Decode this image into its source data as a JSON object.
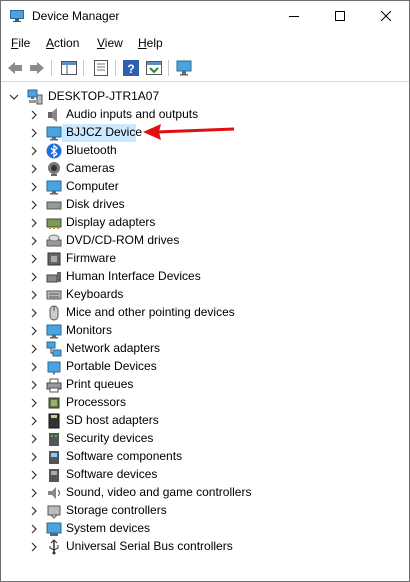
{
  "window": {
    "title": "Device Manager"
  },
  "menu": [
    {
      "first": "F",
      "rest": "ile"
    },
    {
      "first": "A",
      "rest": "ction"
    },
    {
      "first": "V",
      "rest": "iew"
    },
    {
      "first": "H",
      "rest": "elp"
    }
  ],
  "tree": {
    "root": "DESKTOP-JTR1A07",
    "items": [
      {
        "label": "Audio inputs and outputs",
        "icon": "speaker-icon"
      },
      {
        "label": "BJJCZ Device",
        "icon": "monitor-icon",
        "selected": true
      },
      {
        "label": "Bluetooth",
        "icon": "bluetooth-icon"
      },
      {
        "label": "Cameras",
        "icon": "camera-icon"
      },
      {
        "label": "Computer",
        "icon": "computer-icon"
      },
      {
        "label": "Disk drives",
        "icon": "disk-drive-icon"
      },
      {
        "label": "Display adapters",
        "icon": "display-adapter-icon"
      },
      {
        "label": "DVD/CD-ROM drives",
        "icon": "dvd-icon"
      },
      {
        "label": "Firmware",
        "icon": "firmware-icon"
      },
      {
        "label": "Human Interface Devices",
        "icon": "hid-icon"
      },
      {
        "label": "Keyboards",
        "icon": "keyboard-icon"
      },
      {
        "label": "Mice and other pointing devices",
        "icon": "mouse-icon"
      },
      {
        "label": "Monitors",
        "icon": "monitor-icon"
      },
      {
        "label": "Network adapters",
        "icon": "network-adapter-icon"
      },
      {
        "label": "Portable Devices",
        "icon": "portable-device-icon"
      },
      {
        "label": "Print queues",
        "icon": "printer-icon"
      },
      {
        "label": "Processors",
        "icon": "processor-icon"
      },
      {
        "label": "SD host adapters",
        "icon": "sd-card-icon"
      },
      {
        "label": "Security devices",
        "icon": "security-device-icon"
      },
      {
        "label": "Software components",
        "icon": "software-component-icon"
      },
      {
        "label": "Software devices",
        "icon": "software-device-icon"
      },
      {
        "label": "Sound, video and game controllers",
        "icon": "sound-controller-icon"
      },
      {
        "label": "Storage controllers",
        "icon": "storage-controller-icon"
      },
      {
        "label": "System devices",
        "icon": "system-device-icon"
      },
      {
        "label": "Universal Serial Bus controllers",
        "icon": "usb-icon"
      }
    ]
  },
  "colors": {
    "selection": "#cce8ff",
    "annotation_arrow": "#e01010"
  }
}
